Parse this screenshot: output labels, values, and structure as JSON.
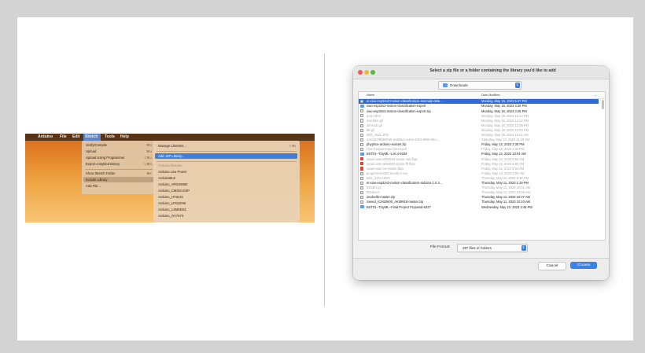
{
  "colors": {
    "accent": "#3a82e8",
    "selection": "#2f6ad9",
    "desktop_orange": "#e58a2e"
  },
  "arduino": {
    "menubar": {
      "apple": "",
      "items": [
        "Arduino",
        "File",
        "Edit",
        "Sketch",
        "Tools",
        "Help"
      ]
    },
    "sketch_menu": {
      "items": [
        {
          "label": "Verify/Compile",
          "shortcut": "⌘R"
        },
        {
          "label": "Upload",
          "shortcut": "⌘U"
        },
        {
          "label": "Upload Using Programmer",
          "shortcut": "⇧⌘U"
        },
        {
          "label": "Export compiled Binary",
          "shortcut": "⌥⌘S"
        },
        {
          "label": "Show Sketch Folder",
          "shortcut": "⌘K"
        },
        {
          "label": "Include Library",
          "shortcut": "›"
        },
        {
          "label": "Add File...",
          "shortcut": ""
        }
      ]
    },
    "library_submenu": {
      "manage": "Manage Libraries...",
      "manage_shortcut": "⇧⌘I",
      "add_zip": "Add .ZIP Library...",
      "section": "Arduino libraries",
      "libraries": [
        "Arduino Low Power",
        "ArduinoBLE",
        "Arduino_APDS9960",
        "Arduino_CMSIS-DSP",
        "Arduino_HTS221",
        "Arduino_LPS22HB",
        "Arduino_LSM9DS1",
        "Arduino_OV767X"
      ]
    }
  },
  "dialog": {
    "title": "Select a zip file or a folder containing the library you'd like to add",
    "location": "Downloads",
    "columns": {
      "name": "Name",
      "date": "Date Modified"
    },
    "files": [
      {
        "name": "ei-xiao-esp32s3-motion-classification-anomaly-dete...",
        "date": "Monday, May 15, 2023 5:37 PM",
        "icon": "zip",
        "state": "selected"
      },
      {
        "name": "xiao-esp32s3-motion-classification-export",
        "date": "Monday, May 15, 2023 4:26 PM",
        "icon": "folder",
        "state": "normal"
      },
      {
        "name": "xiao-esp32s3-motion-classification-export.zip",
        "date": "Monday, May 15, 2023 4:25 PM",
        "icon": "zip",
        "state": "normal"
      },
      {
        "name": "dots.HEIC",
        "date": "Monday, May 15, 2023 12:14 PM",
        "icon": "file",
        "state": "dim"
      },
      {
        "name": "machine.gif",
        "date": "Monday, May 15, 2023 12:12 PM",
        "icon": "file",
        "state": "dim"
      },
      {
        "name": "dimloral.gif",
        "date": "Monday, May 15, 2023 12:08 PM",
        "icon": "file",
        "state": "dim"
      },
      {
        "name": "88.gif",
        "date": "Monday, May 15, 2023 12:03 PM",
        "icon": "file",
        "state": "dim"
      },
      {
        "name": "IMG_1511.JPG",
        "date": "Monday, May 15, 2023 10:21 AM",
        "icon": "file",
        "state": "dim"
      },
      {
        "name": "1AD4579E9MOW-ee9b5cc-e4ee-4304-9600-91c...",
        "date": "Saturday, May 13, 2023 11:19 AM",
        "icon": "file",
        "state": "dim"
      },
      {
        "name": "phyphox-arduino-master.zip",
        "date": "Friday, May 12, 2023 3:35 PM",
        "icon": "zip",
        "state": "normal"
      },
      {
        "name": "Cas-Corpus-Experiment.pdf",
        "date": "Friday, May 12, 2023 1:44 PM",
        "icon": "file",
        "state": "dim"
      },
      {
        "name": "BST01--TinyML--List 4-6334",
        "date": "Friday, May 12, 2023 10:04 AM",
        "icon": "folder",
        "state": "normal"
      },
      {
        "name": "vowel-wav-wf52840-sense-mel.fbps",
        "date": "Friday, May 12, 2023 8:56 AM",
        "icon": "pdf",
        "state": "dim"
      },
      {
        "name": "vowel-wav-wf52840-sense-fft.fbps",
        "date": "Friday, May 12, 2023 8:56 AM",
        "icon": "pdf",
        "state": "dim"
      },
      {
        "name": "vowel-wav-on-mobile.fbps",
        "date": "Friday, May 12, 2023 8:54 AM",
        "icon": "pdf",
        "state": "dim"
      },
      {
        "name": "progress-test01-month-6.csv",
        "date": "Friday, May 12, 2023 8:09 AM",
        "icon": "file",
        "state": "dim"
      },
      {
        "name": "IMG_2191.HEIC",
        "date": "Thursday, May 11, 2023 5:18 PM",
        "icon": "file",
        "state": "dim"
      },
      {
        "name": "ei-xiao-esp32s3-motion-classification-arduino-1.0.3...",
        "date": "Thursday, May 11, 2023 1:29 PM",
        "icon": "zip",
        "state": "normal"
      },
      {
        "name": "IDSdev.py",
        "date": "Thursday, May 11, 2023 10:51 AM",
        "icon": "file",
        "state": "dim"
      },
      {
        "name": "IDSdev.h",
        "date": "Thursday, May 11, 2023 10:49 AM",
        "icon": "file",
        "state": "dim"
      },
      {
        "name": "i2cdevlib-master.zip",
        "date": "Thursday, May 11, 2023 10:27 AM",
        "icon": "zip",
        "state": "normal"
      },
      {
        "name": "Seeed_ICM20600_AK09918-master.zip",
        "date": "Thursday, May 11, 2023 10:10 AM",
        "icon": "zip",
        "state": "normal"
      },
      {
        "name": "BST01--TinyML--Final Project Proposal-6327",
        "date": "Wednesday, May 10, 2023 4:45 PM",
        "icon": "folder",
        "state": "normal"
      }
    ],
    "format_label": "File Format:",
    "format_value": "ZIP files or folders",
    "cancel_label": "Cancel",
    "choose_label": "Choose"
  }
}
